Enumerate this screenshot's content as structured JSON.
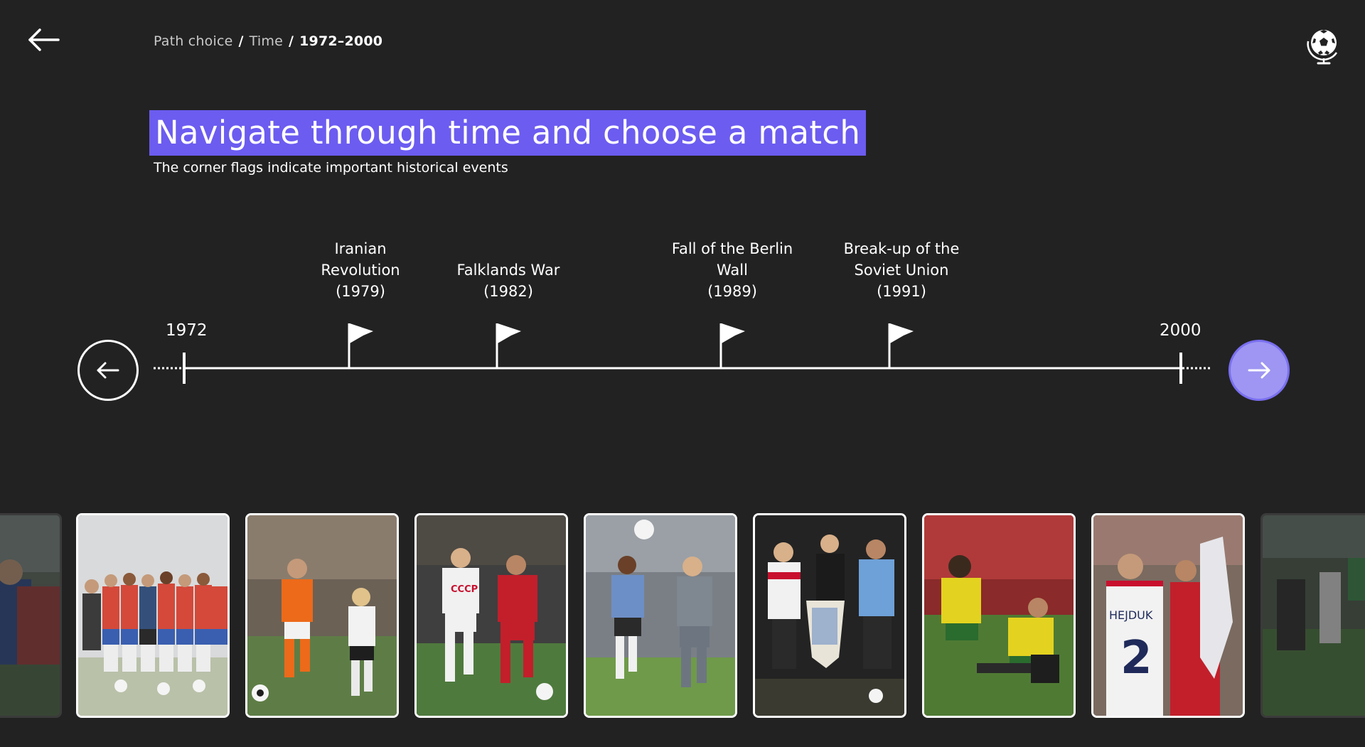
{
  "breadcrumb": {
    "items": [
      "Path choice",
      "Time"
    ],
    "current": "1972–2000",
    "separator": "/"
  },
  "header": {
    "title": "Navigate through time and choose a match",
    "subtitle": "The corner flags indicate important historical events"
  },
  "timeline": {
    "start_year": "1972",
    "end_year": "2000",
    "events": [
      {
        "label": "Iranian\nRevolution\n(1979)",
        "year": 1979
      },
      {
        "label": "Falklands War\n(1982)",
        "year": 1982
      },
      {
        "label": "Fall of the Berlin\nWall\n(1989)",
        "year": 1989
      },
      {
        "label": "Break-up of the\nSoviet Union\n(1991)",
        "year": 1991
      }
    ]
  },
  "icons": {
    "back": "arrow-left-icon",
    "globe": "football-globe-icon",
    "prev": "arrow-left-circle-icon",
    "next": "arrow-right-circle-icon",
    "flag": "corner-flag-icon"
  },
  "cards": {
    "items": [
      {
        "name": "match-card-partial-left",
        "dimmed": true
      },
      {
        "name": "match-card-1",
        "dimmed": false
      },
      {
        "name": "match-card-2",
        "dimmed": false
      },
      {
        "name": "match-card-3",
        "dimmed": false
      },
      {
        "name": "match-card-4",
        "dimmed": false
      },
      {
        "name": "match-card-5",
        "dimmed": false
      },
      {
        "name": "match-card-6",
        "dimmed": false
      },
      {
        "name": "match-card-7",
        "dimmed": false,
        "shirt_text": "HEJDUK",
        "shirt_number": "2"
      },
      {
        "name": "match-card-partial-right",
        "dimmed": true
      }
    ]
  },
  "colors": {
    "background": "#222222",
    "accent": "#6c5cf0",
    "next_button": "#9e96f2",
    "text": "#ffffff"
  }
}
